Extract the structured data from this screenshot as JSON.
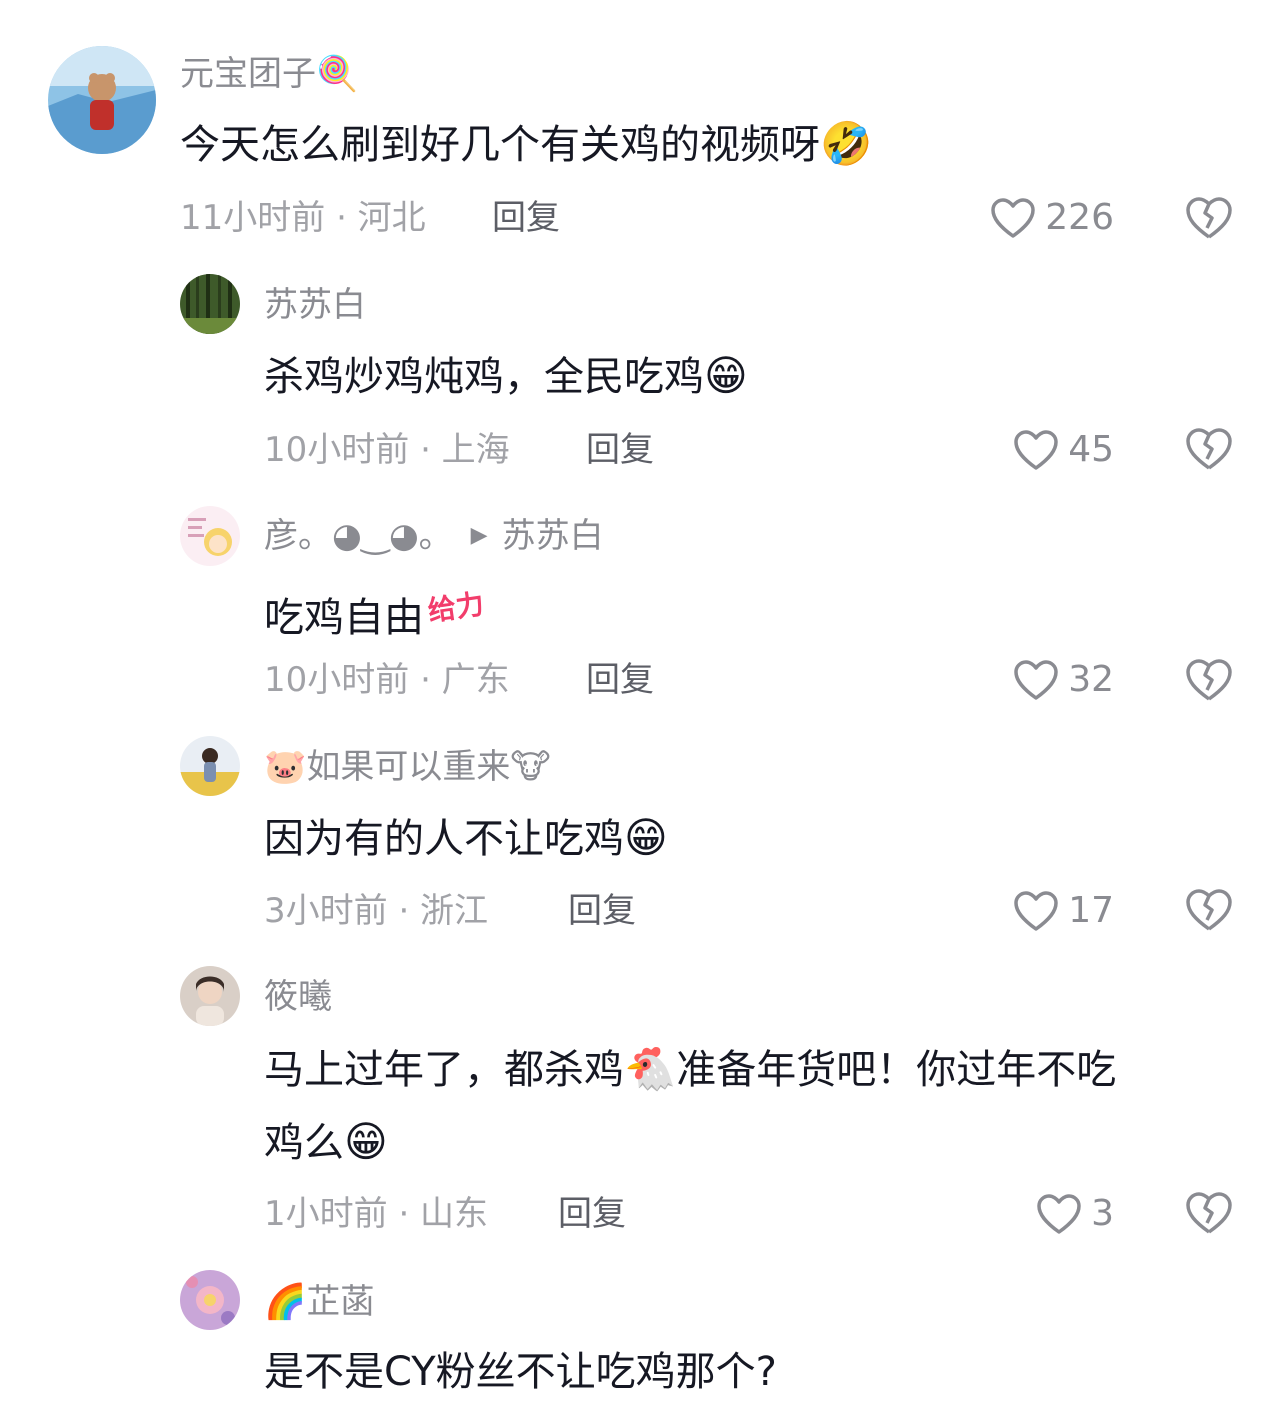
{
  "comments": [
    {
      "name": "元宝团子",
      "name_emoji": "🍭",
      "text": "今天怎么刷到好几个有关鸡的视频呀",
      "text_emoji": "🤣",
      "time_location": "11小时前 · 河北",
      "reply_label": "回复",
      "likes": "226"
    },
    {
      "name": "苏苏白",
      "text": "杀鸡炒鸡炖鸡，全民吃鸡",
      "text_emoji": "😁",
      "time_location": "10小时前 · 上海",
      "reply_label": "回复",
      "likes": "45"
    },
    {
      "name": "彦。◕‿◕。",
      "reply_to": "苏苏白",
      "text": "吃鸡自由",
      "sticker": "给力",
      "time_location": "10小时前 · 广东",
      "reply_label": "回复",
      "likes": "32"
    },
    {
      "name_emoji_before": "🐷",
      "name": "如果可以重来",
      "name_emoji": "🐮",
      "text": "因为有的人不让吃鸡",
      "text_emoji": "😁",
      "time_location": "3小时前 · 浙江",
      "reply_label": "回复",
      "likes": "17"
    },
    {
      "name": "筱曦",
      "text_line1_a": "马上过年了，都杀鸡",
      "text_line1_emoji": "🐔",
      "text_line1_b": "准备年货吧！你过年不吃",
      "text_line2": "鸡么",
      "text_line2_emoji": "😁",
      "time_location": "1小时前 · 山东",
      "reply_label": "回复",
      "likes": "3"
    },
    {
      "name_emoji_before": "🌈",
      "name": "芷菡",
      "text": "是不是CY粉丝不让吃鸡那个?"
    }
  ],
  "colors": {
    "name": "#8a8b91",
    "text": "#161823",
    "meta": "#a1a2a7",
    "reply": "#5c5e66"
  },
  "icons": [
    "heart-outline-icon",
    "broken-heart-icon"
  ]
}
